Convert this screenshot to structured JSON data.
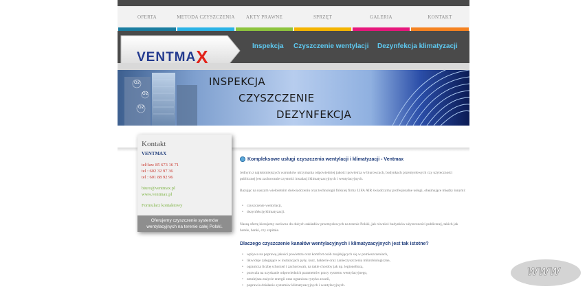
{
  "nav": {
    "items": [
      {
        "label": "OFERTA",
        "color": "#1a7da0"
      },
      {
        "label": "METODA CZYSZCZENIA",
        "color": "#2ab3e6"
      },
      {
        "label": "AKTY PRAWNE",
        "color": "#8dc43e"
      },
      {
        "label": "SPRZĘT",
        "color": "#f4b400"
      },
      {
        "label": "GALERIA",
        "color": "#e6177c"
      },
      {
        "label": "KONTAKT",
        "color": "#f58220"
      }
    ]
  },
  "banner": {
    "logo_main": "VENTMA",
    "logo_x": "X",
    "links": [
      "Inspekcja",
      "Czyszczenie wentylacji",
      "Dezynfekcja klimatyzacji"
    ]
  },
  "hero": {
    "lines": [
      "INSPEKCJA",
      "CZYSZCZENIE",
      "DEZYNFEKCJA"
    ],
    "o2_labels": [
      "O2",
      "O2",
      "O2"
    ]
  },
  "sidebar": {
    "title": "Kontakt",
    "company": "VENTMAX",
    "phones": [
      "tel/fax: 85 673 16 71",
      "tel : 602 32 97 36",
      "tel : 601 88 92 96"
    ],
    "email": "biuro@ventmax.pl",
    "website": "www.ventmax.pl",
    "form_link": "Formularz kontaktowy",
    "footer": "Oferujemy czyszczenie systemów wentylacyjnych na terenie całej Polski."
  },
  "content": {
    "heading": "Kompleksowe usługi czyszczenia wentylacji i klimatyzacji - Ventmax",
    "p1": "Jednym z najistotniejszych warunków utrzymania odpowiedniej jakości powietrza w biurowcach, budynkach przemysłowych czy użyteczności publicznej jest zachowanie czystości instalacji klimatyzacyjnych i wentylacyjnych.",
    "p2": "Bazując na naszym wieloletnim doświadczeniu oraz technologii fińskiej firmy LIFA AIR świadczymy profesjonalne usługi, obejmujące między innymi:",
    "list1": [
      "czyszczenie wentylacji,",
      "dezynfekcję klimatyzacji."
    ],
    "p3": "Naszą ofertę kierujemy zarówno do dużych zakładów przemysłowych na terenie Polski, jak również budynków użyteczności publicznej, takich jak hotele, banki, czy szpitale.",
    "question": "Dlaczego czyszczenie kanałów wentylacyjnych i klimatyzacyjnych jest tak istotne?",
    "list2": [
      "wpływa na poprawę jakości powietrza oraz komfort osób znajdujących się w pomieszczeniach,",
      "likwiduje zalegające w instalacjach pyły, kurz, bakterie oraz zanieczyszczenia mikrobiologiczne,",
      "ogranicza liczbę schorzeń i zachorowań, na takie choroby jak np. legionelloza,",
      "pozwala na uzyskanie odpowiednich parametrów pracy systemu wentylacyjnego,",
      "zmniejsza zużycie energii oraz ogranicza ryzyko awarii,",
      "poprawia działanie systemów klimatyzacyjnych i wentylacyjnych."
    ]
  },
  "badge": {
    "label": "WWW"
  }
}
